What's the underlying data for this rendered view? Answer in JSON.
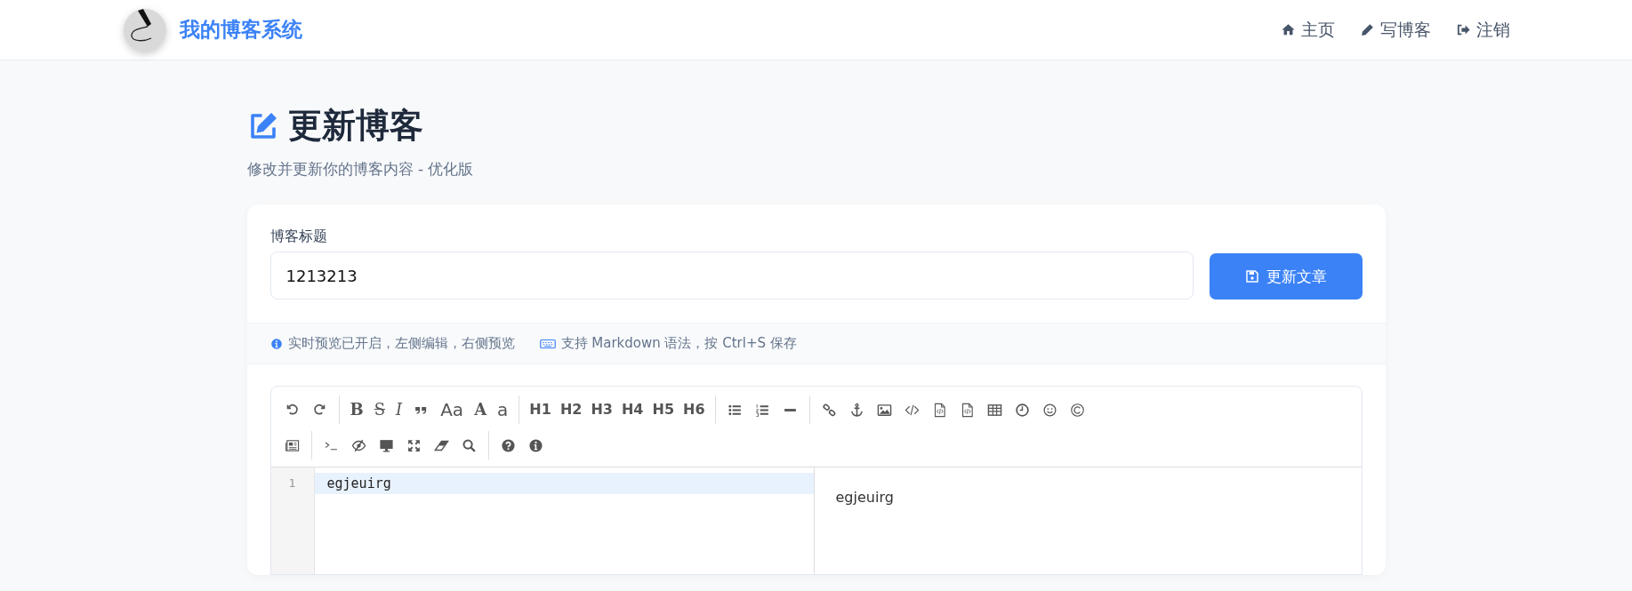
{
  "header": {
    "brand": "我的博客系统",
    "nav": [
      {
        "label": "主页"
      },
      {
        "label": "写博客"
      },
      {
        "label": "注销"
      }
    ]
  },
  "page": {
    "title": "更新博客",
    "subtitle": "修改并更新你的博客内容 - 优化版"
  },
  "form": {
    "title_label": "博客标题",
    "title_value": "1213213",
    "submit": "更新文章"
  },
  "tips": [
    "实时预览已开启，左侧编辑，右侧预览",
    "支持 Markdown 语法，按 Ctrl+S 保存"
  ],
  "toolbar": {
    "rows": [
      [
        [
          {
            "kind": "icon"
          },
          {
            "kind": "icon"
          }
        ],
        [
          {
            "kind": "serif",
            "label": "B"
          },
          {
            "kind": "strike",
            "label": "S"
          },
          {
            "kind": "italic",
            "label": "I"
          },
          {
            "kind": "icon"
          },
          {
            "kind": "sans",
            "label": "Aa"
          },
          {
            "kind": "serif",
            "label": "A"
          },
          {
            "kind": "sans",
            "label": "a"
          }
        ],
        [
          {
            "kind": "heading",
            "label": "H1"
          },
          {
            "kind": "heading",
            "label": "H2"
          },
          {
            "kind": "heading",
            "label": "H3"
          },
          {
            "kind": "heading",
            "label": "H4"
          },
          {
            "kind": "heading",
            "label": "H5"
          },
          {
            "kind": "heading",
            "label": "H6"
          }
        ],
        [
          {
            "kind": "icon"
          },
          {
            "kind": "icon"
          },
          {
            "kind": "icon"
          }
        ],
        [
          {
            "kind": "icon"
          },
          {
            "kind": "icon"
          },
          {
            "kind": "icon"
          },
          {
            "kind": "icon"
          },
          {
            "kind": "icon"
          },
          {
            "kind": "icon"
          },
          {
            "kind": "icon"
          },
          {
            "kind": "icon"
          },
          {
            "kind": "icon"
          },
          {
            "kind": "icon"
          }
        ]
      ],
      [
        [
          {
            "kind": "icon"
          }
        ],
        [
          {
            "kind": "icon"
          },
          {
            "kind": "icon"
          },
          {
            "kind": "icon"
          },
          {
            "kind": "icon"
          },
          {
            "kind": "icon"
          },
          {
            "kind": "icon"
          }
        ],
        [
          {
            "kind": "icon"
          },
          {
            "kind": "icon"
          }
        ]
      ]
    ]
  },
  "editor": {
    "lines": [
      {
        "number": "1",
        "text": "egjeuirg",
        "active": true
      }
    ]
  },
  "preview": {
    "paragraphs": [
      "egjeuirg"
    ]
  }
}
